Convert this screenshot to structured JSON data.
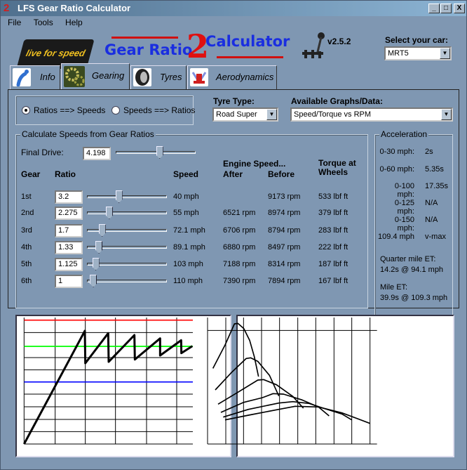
{
  "window": {
    "title": "LFS Gear Ratio Calculator",
    "icon": "2",
    "controls": {
      "minimize": "_",
      "maximize": "□",
      "close": "X"
    }
  },
  "menu": [
    "File",
    "Tools",
    "Help"
  ],
  "header": {
    "logo_text": "live for speed",
    "app_title_left": "Gear Ratio",
    "app_title_num": "2",
    "app_title_right": "Calculator",
    "version": "v2.5.2",
    "car_label": "Select your car:",
    "car_value": "MRT5"
  },
  "tabs": [
    {
      "label": "Info",
      "icon": "info-icon"
    },
    {
      "label": "Gearing",
      "icon": "gears-icon"
    },
    {
      "label": "Tyres",
      "icon": "tyre-icon"
    },
    {
      "label": "Aerodynamics",
      "icon": "car-icon"
    }
  ],
  "mode": {
    "options": [
      "Ratios ==> Speeds",
      "Speeds ==> Ratios"
    ],
    "selected": 0
  },
  "tyre": {
    "label": "Tyre Type:",
    "value": "Road Super"
  },
  "graphs": {
    "label": "Available Graphs/Data:",
    "value": "Speed/Torque vs RPM"
  },
  "calc": {
    "title": "Calculate Speeds from Gear Ratios",
    "final_drive_label": "Final Drive:",
    "final_drive": "4.198",
    "final_drive_slider": 0.55,
    "headers": {
      "gear": "Gear",
      "ratio": "Ratio",
      "speed": "Speed",
      "engine": "Engine Speed...",
      "after": "After",
      "before": "Before",
      "torque": "Torque at Wheels"
    },
    "rows": [
      {
        "gear": "1st",
        "ratio": "3.2",
        "slider": 0.4,
        "speed": "40 mph",
        "after": "",
        "before": "9173 rpm",
        "torque": "533 lbf ft"
      },
      {
        "gear": "2nd",
        "ratio": "2.275",
        "slider": 0.28,
        "speed": "55 mph",
        "after": "6521 rpm",
        "before": "8974 rpm",
        "torque": "379 lbf ft"
      },
      {
        "gear": "3rd",
        "ratio": "1.7",
        "slider": 0.19,
        "speed": "72.1 mph",
        "after": "6706 rpm",
        "before": "8794 rpm",
        "torque": "283 lbf ft"
      },
      {
        "gear": "4th",
        "ratio": "1.33",
        "slider": 0.15,
        "speed": "89.1 mph",
        "after": "6880 rpm",
        "before": "8497 rpm",
        "torque": "222 lbf ft"
      },
      {
        "gear": "5th",
        "ratio": "1.125",
        "slider": 0.11,
        "speed": "103 mph",
        "after": "7188 rpm",
        "before": "8314 rpm",
        "torque": "187 lbf ft"
      },
      {
        "gear": "6th",
        "ratio": "1",
        "slider": 0.08,
        "speed": "110 mph",
        "after": "7390 rpm",
        "before": "7894 rpm",
        "torque": "167 lbf ft"
      }
    ]
  },
  "acceleration": {
    "title": "Acceleration",
    "rows": [
      {
        "label": "0-30 mph:",
        "value": "2s"
      },
      {
        "label": "0-60 mph:",
        "value": "5.35s"
      },
      {
        "label": "0-100 mph:",
        "value": "17.35s"
      },
      {
        "label": "0-125 mph:",
        "value": "N/A"
      },
      {
        "label": "0-150 mph:",
        "value": "N/A"
      },
      {
        "label": "109.4 mph",
        "value": "v-max"
      }
    ],
    "quarter_label": "Quarter mile ET:",
    "quarter_value": "14.2s @ 94.1 mph",
    "mile_label": "Mile ET:",
    "mile_value": "39.9s @ 109.3 mph"
  },
  "colors": {
    "red_line": "#ff0000",
    "green_line": "#00ff00",
    "blue_line": "#0000ff"
  }
}
